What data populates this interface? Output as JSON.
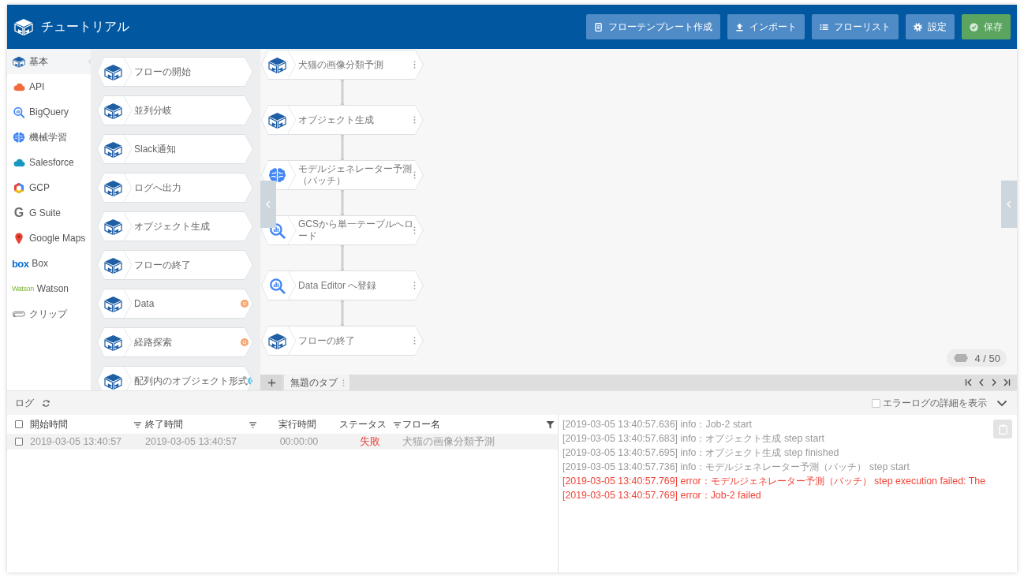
{
  "header": {
    "title": "チュートリアル",
    "buttons": [
      {
        "label": "フローテンプレート作成",
        "kind": "template"
      },
      {
        "label": "インポート",
        "kind": "import"
      },
      {
        "label": "フローリスト",
        "kind": "list"
      },
      {
        "label": "設定",
        "kind": "settings"
      },
      {
        "label": "保存",
        "kind": "save"
      }
    ]
  },
  "sidebar": {
    "items": [
      {
        "label": "基本",
        "kind": "basic",
        "selected": true
      },
      {
        "label": "API",
        "kind": "api",
        "selected": false
      },
      {
        "label": "BigQuery",
        "kind": "bigquery",
        "selected": false
      },
      {
        "label": "機械学習",
        "kind": "ml",
        "selected": false
      },
      {
        "label": "Salesforce",
        "kind": "salesforce",
        "selected": false
      },
      {
        "label": "GCP",
        "kind": "gcp",
        "selected": false
      },
      {
        "label": "G Suite",
        "kind": "gsuite",
        "logo": "G",
        "selected": false
      },
      {
        "label": "Google Maps",
        "kind": "maps",
        "selected": false
      },
      {
        "label": "Box",
        "kind": "box",
        "logo": "box",
        "selected": false
      },
      {
        "label": "Watson",
        "kind": "watson",
        "logo": "Watson",
        "selected": false
      },
      {
        "label": "クリップ",
        "kind": "clip",
        "selected": false
      }
    ]
  },
  "palette": {
    "nodes": [
      {
        "label": "フローの開始"
      },
      {
        "label": "並列分岐"
      },
      {
        "label": "Slack通知"
      },
      {
        "label": "ログへ出力"
      },
      {
        "label": "オブジェクト生成"
      },
      {
        "label": "フローの終了"
      },
      {
        "label": "Data",
        "color": "#f7a56e"
      },
      {
        "label": "経路探索",
        "color": "#f7a56e"
      },
      {
        "label": "配列内のオブジェクト形式",
        "color": "#5fc7ea"
      }
    ]
  },
  "canvas": {
    "nodes": [
      {
        "label": "犬猫の画像分類予測",
        "kind": "basic"
      },
      {
        "label": "オブジェクト生成",
        "kind": "basic"
      },
      {
        "label": "モデルジェネレーター予測（バッチ）",
        "kind": "ml"
      },
      {
        "label": "GCSから単一テーブルへロード",
        "kind": "bigquery"
      },
      {
        "label": "Data Editor へ登録",
        "kind": "bigquery"
      },
      {
        "label": "フローの終了",
        "kind": "basic"
      }
    ],
    "counter": "4 / 50"
  },
  "tabs": [
    {
      "label": "無題のタブ",
      "selected": true
    }
  ],
  "log": {
    "title": "ログ",
    "error_detail": {
      "label": "エラーログの詳細を表示",
      "checked": false
    },
    "table": {
      "all_checked": false,
      "columns": [
        {
          "label": "開始時間",
          "sortable": true,
          "filterable": false
        },
        {
          "label": "終了時間",
          "sortable": true,
          "filterable": false
        },
        {
          "label": "実行時間",
          "sortable": false,
          "filterable": false
        },
        {
          "label": "ステータス",
          "sortable": true,
          "filterable": false
        },
        {
          "label": "フロー名",
          "sortable": false,
          "filterable": true
        }
      ],
      "rows": [
        {
          "checked": false,
          "selected": true,
          "start": "2019-03-05 13:40:57",
          "end": "2019-03-05 13:40:57",
          "duration": "00:00:00",
          "status": "失敗",
          "color": "#e8453c",
          "flow": "犬猫の画像分類予測"
        }
      ]
    },
    "lines": [
      {
        "kind": "info",
        "text": "[2019-03-05 13:40:57.636] info：Job-2 start"
      },
      {
        "kind": "info",
        "text": "[2019-03-05 13:40:57.683] info：オブジェクト生成 step start"
      },
      {
        "kind": "info",
        "text": "[2019-03-05 13:40:57.695] info：オブジェクト生成 step finished"
      },
      {
        "kind": "info",
        "text": "[2019-03-05 13:40:57.736] info：モデルジェネレーター予測（バッチ） step start"
      },
      {
        "kind": "error",
        "text": "[2019-03-05 13:40:57.769] error：モデルジェネレーター予測（バッチ） step execution failed: The"
      },
      {
        "kind": "error",
        "text": "[2019-03-05 13:40:57.769] error：Job-2 failed"
      }
    ]
  }
}
